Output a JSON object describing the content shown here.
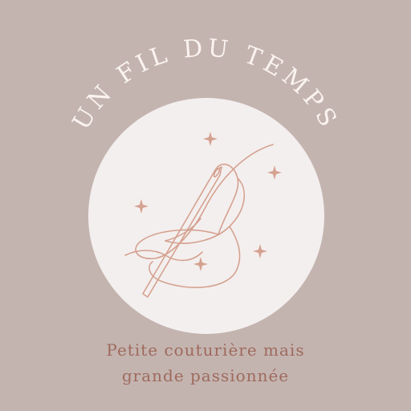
{
  "brand": {
    "title": "UN FIL DU TEMPS",
    "colors": {
      "background": "#c4b4b0",
      "circle": "#f3efee",
      "title_text": "#faf3ef",
      "line_art": "#d5a190",
      "tagline_text": "#9e6a5c"
    },
    "icons": [
      "needle-and-thread-logo",
      "sparkle-icon"
    ]
  },
  "tagline": {
    "line1": "Petite couturière mais",
    "line2": "grande passionnée"
  }
}
